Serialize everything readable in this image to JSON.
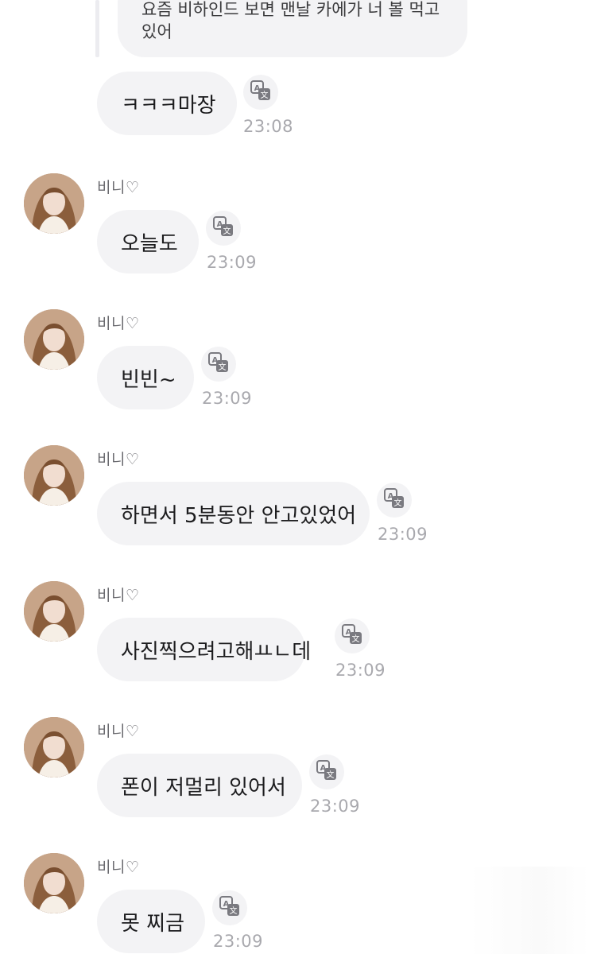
{
  "quote": {
    "text": "요즘 비하인드 보면 맨날 카에가 너 볼 먹고\n있어"
  },
  "messages": [
    {
      "sender": "",
      "text": "ㅋㅋㅋ마장",
      "time": "23:08"
    },
    {
      "sender": "비니♡",
      "text": "오늘도",
      "time": "23:09"
    },
    {
      "sender": "비니♡",
      "text": "빈빈~",
      "time": "23:09"
    },
    {
      "sender": "비니♡",
      "text": "하면서 5분동안 안고있었어",
      "time": "23:09"
    },
    {
      "sender": "비니♡",
      "text": "사진찍으려고해ㅛㄴ데",
      "time": "23:09"
    },
    {
      "sender": "비니♡",
      "text": "폰이 저멀리 있어서",
      "time": "23:09"
    },
    {
      "sender": "비니♡",
      "text": "못 찌금",
      "time": "23:09"
    }
  ],
  "icons": {
    "translate": "translate-icon",
    "avatar": "avatar-image"
  },
  "colors": {
    "bubble": "#f3f3f5",
    "time": "#a9a9ae",
    "sender": "#6b6b70"
  }
}
